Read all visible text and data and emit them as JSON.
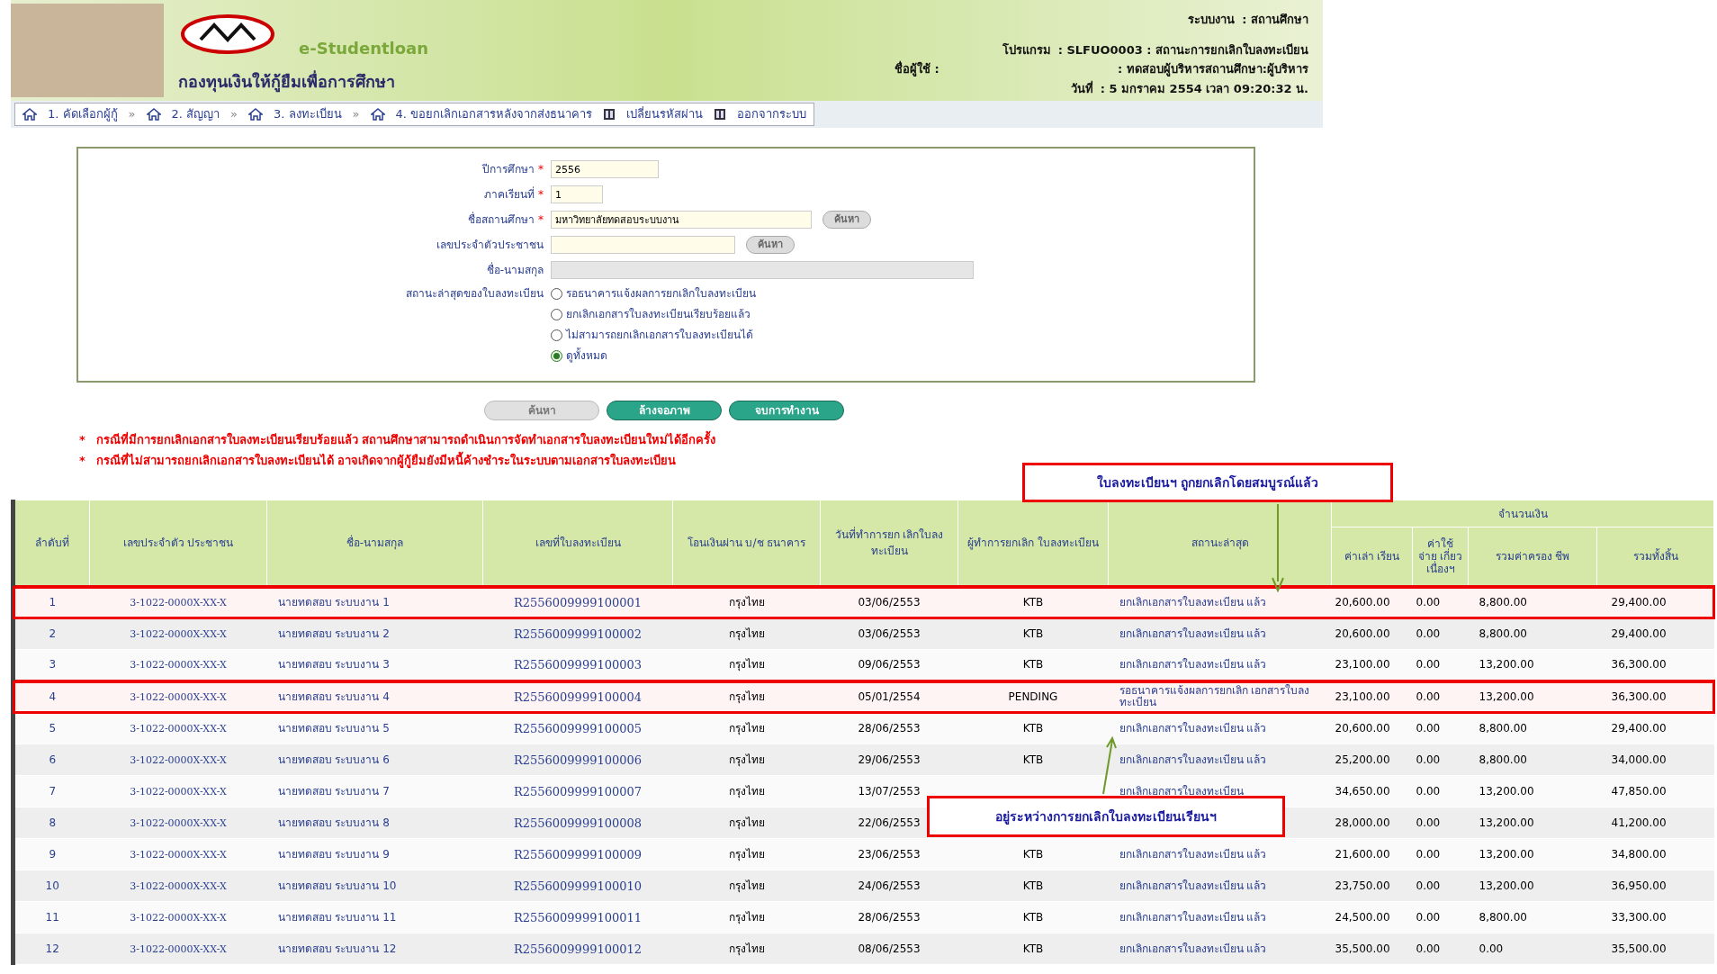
{
  "header": {
    "brand": "e-Studentloan",
    "org_name": "กองทุนเงินให้กู้ยืมเพื่อการศึกษา",
    "system_label": "ระบบงาน",
    "system_value": ": สถานศึกษา",
    "program_label": "โปรแกรม",
    "program_value": ": SLFUO0003  : สถานะการยกเลิกใบลงทะเบียน",
    "user_label": "ชื่อผู้ใช้ :",
    "user_value": ": ทดสอบผู้บริหารสถานศึกษา:ผู้บริหาร",
    "date_label": "วันที่",
    "date_value": ": 5 มกราคม 2554 เวลา 09:20:32 น."
  },
  "nav": [
    {
      "label": "1. คัดเลือกผู้กู้",
      "kind": "home"
    },
    {
      "label": "2. สัญญา",
      "kind": "home"
    },
    {
      "label": "3. ลงทะเบียน",
      "kind": "home"
    },
    {
      "label": "4. ขอยกเลิกเอกสารหลังจากส่งธนาคาร",
      "kind": "home"
    },
    {
      "label": "เปลี่ยนรหัสผ่าน",
      "kind": "door"
    },
    {
      "label": "ออกจากระบบ",
      "kind": "door"
    }
  ],
  "nav_separator": "»",
  "form": {
    "fields": [
      {
        "label": "ปีการศึกษา",
        "required": true,
        "value": "2556",
        "kind": "short"
      },
      {
        "label": "ภาคเรียนที่",
        "required": true,
        "value": "1",
        "kind": "tiny"
      },
      {
        "label": "ชื่อสถานศึกษา",
        "required": true,
        "value": "มหาวิทยาลัยทดสอบระบบงาน",
        "kind": "search",
        "button": "ค้นหา"
      },
      {
        "label": "เลขประจำตัวประชาชน",
        "required": false,
        "kind": "search",
        "button": "ค้นหา"
      },
      {
        "label": "ชื่อ-นามสกุล",
        "required": false,
        "kind": "disabled"
      }
    ],
    "required_mark": "*",
    "status_label": "สถานะล่าสุดของใบลงทะเบียน",
    "status_options": [
      {
        "label": "รอธนาคารแจ้งผลการยกเลิกใบลงทะเบียน",
        "selected": false
      },
      {
        "label": "ยกเลิกเอกสารใบลงทะเบียนเรียบร้อยแล้ว",
        "selected": false
      },
      {
        "label": "ไม่สามารถยกเลิกเอกสารใบลงทะเบียนได้",
        "selected": false
      },
      {
        "label": "ดูทั้งหมด",
        "selected": true
      }
    ]
  },
  "buttons": [
    {
      "label": "ค้นหา",
      "disabled": true
    },
    {
      "label": "ล้างจอภาพ",
      "disabled": false
    },
    {
      "label": "จบการทำงาน",
      "disabled": false
    }
  ],
  "notes": [
    "กรณีที่มีการยกเลิกเอกสารใบลงทะเบียนเรียบร้อยแล้ว สถานศึกษาสามารถดำเนินการจัดทำเอกสารใบลงทะเบียนใหม่ได้อีกครั้ง",
    "กรณีที่ไม่สามารถยกเลิกเอกสารใบลงทะเบียนได้  อาจเกิดจากผู้กู้ยืมยังมีหนี้ค้างชำระในระบบตามเอกสารใบลงทะเบียน"
  ],
  "note_mark": "*",
  "callouts": [
    "ใบลงทะเบียนฯ ถูกยกเลิกโดยสมบูรณ์แล้ว",
    "อยู่ระหว่างการยกเลิกใบลงทะเบียนเรียนฯ"
  ],
  "table": {
    "columns": [
      "ลำดับที่",
      "เลขประจำตัว ประชาชน",
      "ชื่อ-นามสกุล",
      "เลขที่ใบลงทะเบียน",
      "โอนเงินผ่าน บ/ช ธนาคาร",
      "วันที่ทำการยก เลิกใบลงทะเบียน",
      "ผู้ทำการยกเลิก ใบลงทะเบียน",
      "สถานะล่าสุด"
    ],
    "money_group": "จำนวนเงิน",
    "money_columns": [
      "ค่าเล่า เรียน",
      "ค่าใช้ จ่าย เกี่ยว เนื่องฯ",
      "รวมค่าครอง ชีพ",
      "รวมทั้งสิ้น"
    ],
    "rows": [
      {
        "no": "1",
        "id": "3-1022-0000X-XX-X",
        "name": "นายทดสอบ  ระบบงาน 1",
        "reg": "R2556009999100001",
        "bank": "กรุงไทย",
        "date": "03/06/2553",
        "by": "KTB",
        "status": "ยกเลิกเอกสารใบลงทะเบียน แล้ว",
        "tuition": "20,600.00",
        "fee": "0.00",
        "living": "8,800.00",
        "total": "29,400.00",
        "highlighted": true
      },
      {
        "no": "2",
        "id": "3-1022-0000X-XX-X",
        "name": "นายทดสอบ  ระบบงาน 2",
        "reg": "R2556009999100002",
        "bank": "กรุงไทย",
        "date": "03/06/2553",
        "by": "KTB",
        "status": "ยกเลิกเอกสารใบลงทะเบียน แล้ว",
        "tuition": "20,600.00",
        "fee": "0.00",
        "living": "8,800.00",
        "total": "29,400.00",
        "highlighted": false
      },
      {
        "no": "3",
        "id": "3-1022-0000X-XX-X",
        "name": "นายทดสอบ  ระบบงาน 3",
        "reg": "R2556009999100003",
        "bank": "กรุงไทย",
        "date": "09/06/2553",
        "by": "KTB",
        "status": "ยกเลิกเอกสารใบลงทะเบียน แล้ว",
        "tuition": "23,100.00",
        "fee": "0.00",
        "living": "13,200.00",
        "total": "36,300.00",
        "highlighted": false
      },
      {
        "no": "4",
        "id": "3-1022-0000X-XX-X",
        "name": "นายทดสอบ  ระบบงาน 4",
        "reg": "R2556009999100004",
        "bank": "กรุงไทย",
        "date": "05/01/2554",
        "by": "PENDING",
        "status": "รอธนาคารแจ้งผลการยกเลิก เอกสารใบลงทะเบียน",
        "tuition": "23,100.00",
        "fee": "0.00",
        "living": "13,200.00",
        "total": "36,300.00",
        "highlighted": true
      },
      {
        "no": "5",
        "id": "3-1022-0000X-XX-X",
        "name": "นายทดสอบ  ระบบงาน 5",
        "reg": "R2556009999100005",
        "bank": "กรุงไทย",
        "date": "28/06/2553",
        "by": "KTB",
        "status": "ยกเลิกเอกสารใบลงทะเบียน แล้ว",
        "tuition": "20,600.00",
        "fee": "0.00",
        "living": "8,800.00",
        "total": "29,400.00",
        "highlighted": false
      },
      {
        "no": "6",
        "id": "3-1022-0000X-XX-X",
        "name": "นายทดสอบ  ระบบงาน 6",
        "reg": "R2556009999100006",
        "bank": "กรุงไทย",
        "date": "29/06/2553",
        "by": "KTB",
        "status": "ยกเลิกเอกสารใบลงทะเบียน แล้ว",
        "tuition": "25,200.00",
        "fee": "0.00",
        "living": "8,800.00",
        "total": "34,000.00",
        "highlighted": false
      },
      {
        "no": "7",
        "id": "3-1022-0000X-XX-X",
        "name": "นายทดสอบ  ระบบงาน 7",
        "reg": "R2556009999100007",
        "bank": "กรุงไทย",
        "date": "13/07/2553",
        "status": "ยกเลิกเอกสารใบลงทะเบียน",
        "tuition": "34,650.00",
        "fee": "0.00",
        "living": "13,200.00",
        "total": "47,850.00",
        "highlighted": false
      },
      {
        "no": "8",
        "id": "3-1022-0000X-XX-X",
        "name": "นายทดสอบ  ระบบงาน 8",
        "reg": "R2556009999100008",
        "bank": "กรุงไทย",
        "date": "22/06/2553",
        "tuition": "28,000.00",
        "fee": "0.00",
        "living": "13,200.00",
        "total": "41,200.00",
        "highlighted": false
      },
      {
        "no": "9",
        "id": "3-1022-0000X-XX-X",
        "name": "นายทดสอบ  ระบบงาน 9",
        "reg": "R2556009999100009",
        "bank": "กรุงไทย",
        "date": "23/06/2553",
        "by": "KTB",
        "status": "ยกเลิกเอกสารใบลงทะเบียน แล้ว",
        "tuition": "21,600.00",
        "fee": "0.00",
        "living": "13,200.00",
        "total": "34,800.00",
        "highlighted": false
      },
      {
        "no": "10",
        "id": "3-1022-0000X-XX-X",
        "name": "นายทดสอบ  ระบบงาน 10",
        "reg": "R2556009999100010",
        "bank": "กรุงไทย",
        "date": "24/06/2553",
        "by": "KTB",
        "status": "ยกเลิกเอกสารใบลงทะเบียน แล้ว",
        "tuition": "23,750.00",
        "fee": "0.00",
        "living": "13,200.00",
        "total": "36,950.00",
        "highlighted": false
      },
      {
        "no": "11",
        "id": "3-1022-0000X-XX-X",
        "name": "นายทดสอบ  ระบบงาน 11",
        "reg": "R2556009999100011",
        "bank": "กรุงไทย",
        "date": "28/06/2553",
        "by": "KTB",
        "status": "ยกเลิกเอกสารใบลงทะเบียน แล้ว",
        "tuition": "24,500.00",
        "fee": "0.00",
        "living": "8,800.00",
        "total": "33,300.00",
        "highlighted": false
      },
      {
        "no": "12",
        "id": "3-1022-0000X-XX-X",
        "name": "นายทดสอบ  ระบบงาน 12",
        "reg": "R2556009999100012",
        "bank": "กรุงไทย",
        "date": "08/06/2553",
        "by": "KTB",
        "status": "ยกเลิกเอกสารใบลงทะเบียน แล้ว",
        "tuition": "35,500.00",
        "fee": "0.00",
        "living": "0.00",
        "total": "35,500.00",
        "highlighted": false
      }
    ]
  }
}
